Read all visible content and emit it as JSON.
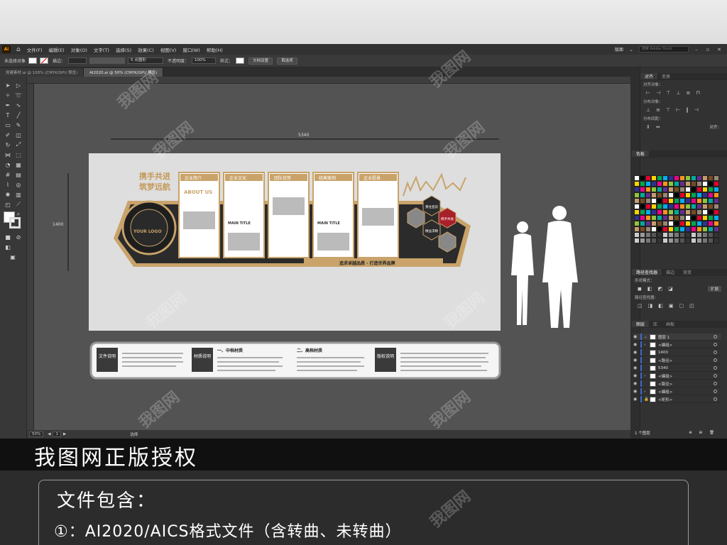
{
  "menubar": {
    "app_badge": "Ai",
    "items": [
      "文件(F)",
      "编辑(E)",
      "对象(O)",
      "文字(T)",
      "选择(S)",
      "效果(C)",
      "视图(V)",
      "窗口(W)",
      "帮助(H)"
    ],
    "layout_label": "版面",
    "search_placeholder": "搜索 Adobe Stock"
  },
  "controlbar": {
    "selection": "未选择对象",
    "stroke_label": "描边：",
    "brush": "5 点圆形",
    "opacity_label": "不透明度：",
    "opacity_value": "100%",
    "style_label": "样式：",
    "doc_setup": "文档设置",
    "preferences": "首选项"
  },
  "tabs": [
    {
      "label": "党建素材.ai @ 100% (CMYK/GPU 预览)"
    },
    {
      "label": "AI2020.ai @ 50% (CMYK/GPU 预览)"
    }
  ],
  "artboard": {
    "dim_width": "5340",
    "dim_height": "1400",
    "slogan_1": "携手共进",
    "slogan_2": "筑梦远航",
    "logo_text": "YOUR LOGO",
    "card_titles": [
      "企业简介",
      "企业文化",
      "团队优势",
      "经典案例",
      "企业愿景"
    ],
    "about": "ABOUT US",
    "main_title": "MAIN TITLE",
    "hex_labels": [
      "勇往直前",
      "携手共进",
      "精益求精",
      "勇于创新"
    ],
    "bottom_slogan": "追求卓越品质 · 打造世界品牌"
  },
  "notes": {
    "file_label": "文件说明",
    "material_label": "材质说明",
    "copyright_label": "版权说明",
    "mid_material": "一、中档材质",
    "high_material": "二、高档材质"
  },
  "statusbar": {
    "zoom": "50%",
    "page": "1",
    "tool": "选择"
  },
  "panels": {
    "align_tab": "对齐",
    "transform_tab": "变换",
    "align_objects": "对齐对象：",
    "distribute_objects": "分布对象：",
    "distribute_spacing": "分布间距：",
    "align_to": "对齐：",
    "swatches_tab": "色板",
    "pathfinder_tab": "路径查找器",
    "gradient_tab": "描边",
    "transparency_tab": "渐变",
    "shape_modes": "形状模式：",
    "pathfinders": "路径查找器：",
    "expand": "扩展",
    "layers_tab": "图层",
    "artboards_tab": "库",
    "links_tab": "画板",
    "layer_name": "图层 1",
    "layer_items": [
      "<编组>",
      "1400",
      "<路径>",
      "5340",
      "<编组>",
      "<路径>",
      "<编组>",
      "<矩形>"
    ],
    "layer_count": "1 个图层"
  },
  "banner": {
    "title": "我图网正版授权"
  },
  "info": {
    "title": "文件包含：",
    "line1": "①：AI2020/AICS格式文件（含转曲、未转曲）"
  },
  "watermark": "我图网"
}
